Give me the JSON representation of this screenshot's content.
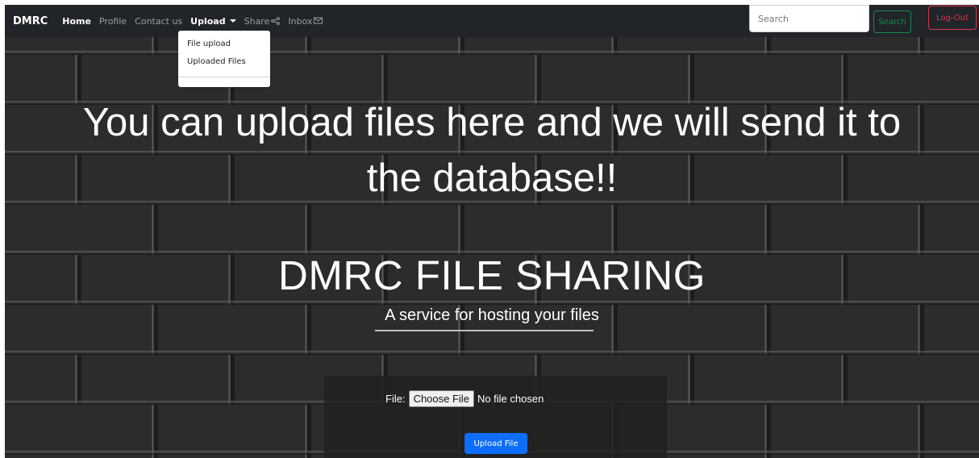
{
  "navbar": {
    "brand": "DMRC",
    "links": {
      "home": "Home",
      "profile": "Profile",
      "contact": "Contact us",
      "upload": "Upload",
      "share": "Share",
      "inbox": "Inbox"
    },
    "search_placeholder": "Search",
    "search_button": "Search",
    "logout_button": "Log-Out"
  },
  "dropdown": {
    "items": [
      "File upload",
      "Uploaded Files"
    ]
  },
  "hero": {
    "headline_line1": "You can upload files here and we will send it to",
    "headline_line2": "the database!!",
    "title": "DMRC FILE SHARING",
    "subtitle": "A service for hosting your files"
  },
  "form": {
    "file_label": "File:",
    "choose_button": "Choose File",
    "file_status": "No file chosen",
    "submit_button": "Upload File"
  },
  "colors": {
    "navbar_bg": "#212529",
    "search_green": "#198754",
    "logout_red": "#dc3545",
    "upload_blue": "#0d6efd"
  }
}
